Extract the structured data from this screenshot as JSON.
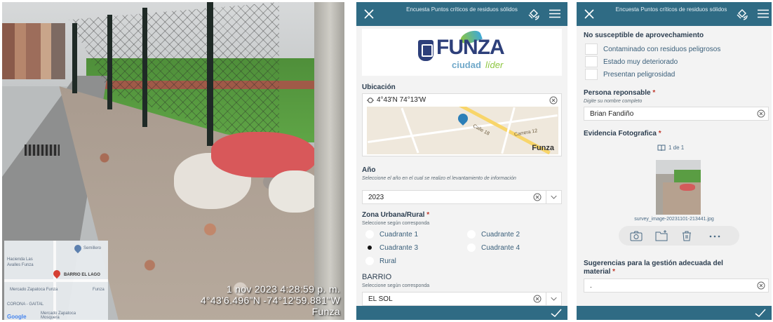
{
  "photo": {
    "stamp_date": "1 nov 2023 4:28:59 p. m.",
    "stamp_coords": "4°43'6.496\"N -74°12'59.881\"W",
    "stamp_place": "Funza",
    "mini_map": {
      "labels": [
        "Semillero",
        "Hacienda Las",
        "Avalles Funza",
        "BARRIO EL LAGO",
        "Mercado Zapatoca Funza",
        "Funza",
        "CORONA - GAITAL",
        "Mercado Zapatoca",
        "Mosquera"
      ],
      "google": "Google"
    }
  },
  "survey": {
    "title": "Encuesta Puntos críticos de residuos sólidos",
    "logo": {
      "main": "FUNZA",
      "sub": "ciudad",
      "sub2": "líder"
    },
    "ubicacion": {
      "label": "Ubicación",
      "value": "4°43'N 74°13'W",
      "map_streets": [
        "Calle 18",
        "Carrera 12"
      ],
      "map_town": "Funza"
    },
    "anio": {
      "label": "Año",
      "hint": "Seleccione el año en el cual se realizo el levantamiento de información",
      "value": "2023"
    },
    "zona": {
      "label": "Zona Urbana/Rural",
      "required": "*",
      "hint": "Seleccione según corresponda",
      "options": [
        "Cuadrante 1",
        "Cuadrante 2",
        "Cuadrante 3",
        "Cuadrante 4",
        "Rural"
      ],
      "selected": "Cuadrante 3"
    },
    "barrio": {
      "label": "BARRIO",
      "hint": "Seleccione según corresponda",
      "value": "EL SOL"
    }
  },
  "survey2": {
    "title": "Encuesta Puntos críticos de residuos sólidos",
    "no_susceptible": {
      "label": "No susceptible de aprovechamiento",
      "options": [
        "Contaminado con residuos peligrosos",
        "Estado muy deteriorado",
        "Presentan peligrosidad"
      ]
    },
    "responsable": {
      "label": "Persona reponsable",
      "required": "*",
      "hint": "Digite su nombre completo",
      "value": "Brian Fandiño"
    },
    "evidencia": {
      "label": "Evidencia Fotografica",
      "required": "*",
      "counter": "1 de 1",
      "filename": "survey_image-20231101-213441.jpg"
    },
    "sugerencias": {
      "label_line1": "Sugerencias para la gestión adecuada del",
      "label_line2": "material",
      "required": "*",
      "value": "."
    }
  },
  "colors": {
    "appbar": "#2f6b84",
    "required": "#c0392b",
    "label": "#2c3e50"
  }
}
